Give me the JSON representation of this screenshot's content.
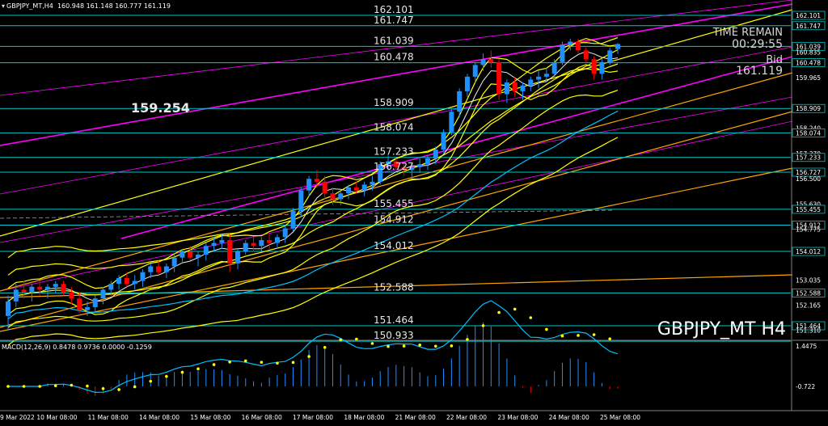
{
  "header": {
    "symbol_tf": "GBPJPY_MT,H4",
    "ohlc": "160.948 161.148 160.777 161.119"
  },
  "watermark": "GBPJPY_MT H4",
  "timer": {
    "label": "TIME REMAIN",
    "value": "00:29:55",
    "bid_label": "Bid",
    "bid_value": "161.119"
  },
  "big_level_label": "159.254",
  "levels": [
    {
      "value": 162.101,
      "label": "162.101"
    },
    {
      "value": 161.747,
      "label": "161.747"
    },
    {
      "value": 161.039,
      "label": "161.039"
    },
    {
      "value": 160.478,
      "label": "160.478"
    },
    {
      "value": 158.909,
      "label": "158.909"
    },
    {
      "value": 158.074,
      "label": "158.074"
    },
    {
      "value": 157.233,
      "label": "157.233"
    },
    {
      "value": 156.727,
      "label": "156.727"
    },
    {
      "value": 155.455,
      "label": "155.455"
    },
    {
      "value": 154.912,
      "label": "154.912"
    },
    {
      "value": 154.012,
      "label": "154.012"
    },
    {
      "value": 152.588,
      "label": "152.588"
    },
    {
      "value": 151.464,
      "label": "151.464"
    },
    {
      "value": 150.933,
      "label": "150.933"
    }
  ],
  "price_axis_ticks": [
    {
      "value": 162.101,
      "label": "162.101",
      "boxed": true
    },
    {
      "value": 161.747,
      "label": "161.747",
      "boxed": true
    },
    {
      "value": 161.039,
      "label": "161.039",
      "boxed": true
    },
    {
      "value": 160.835,
      "label": "160.835",
      "boxed": false
    },
    {
      "value": 160.478,
      "label": "160.478",
      "boxed": true
    },
    {
      "value": 159.965,
      "label": "159.965",
      "boxed": false
    },
    {
      "value": 158.909,
      "label": "158.909",
      "boxed": true
    },
    {
      "value": 158.24,
      "label": "158.240",
      "boxed": false
    },
    {
      "value": 158.074,
      "label": "158.074",
      "boxed": true
    },
    {
      "value": 157.37,
      "label": "157.370",
      "boxed": false
    },
    {
      "value": 157.233,
      "label": "157.233",
      "boxed": true
    },
    {
      "value": 156.727,
      "label": "156.727",
      "boxed": true
    },
    {
      "value": 156.5,
      "label": "156.500",
      "boxed": false
    },
    {
      "value": 155.63,
      "label": "155.630",
      "boxed": false
    },
    {
      "value": 155.455,
      "label": "155.455",
      "boxed": true
    },
    {
      "value": 154.912,
      "label": "154.912",
      "boxed": true
    },
    {
      "value": 154.775,
      "label": "154.775",
      "boxed": false
    },
    {
      "value": 154.012,
      "label": "154.012",
      "boxed": true
    },
    {
      "value": 153.035,
      "label": "153.035",
      "boxed": false
    },
    {
      "value": 152.588,
      "label": "152.588",
      "boxed": true
    },
    {
      "value": 152.165,
      "label": "152.165",
      "boxed": false
    },
    {
      "value": 151.464,
      "label": "151.464",
      "boxed": true
    },
    {
      "value": 151.31,
      "label": "151.310",
      "boxed": false
    }
  ],
  "macd": {
    "label": "MACD(12,26,9) 0.8478 0.9736 0.0000 -0.1259",
    "axis_ticks": [
      {
        "value": 1.4475,
        "label": "1.4475"
      },
      {
        "value": -0.722,
        "label": "-0.722"
      }
    ]
  },
  "time_axis": [
    "9 Mar 2022",
    "10 Mar 08:00",
    "11 Mar 08:00",
    "14 Mar 08:00",
    "15 Mar 08:00",
    "16 Mar 08:00",
    "17 Mar 08:00",
    "18 Mar 08:00",
    "21 Mar 08:00",
    "22 Mar 08:00",
    "23 Mar 08:00",
    "24 Mar 08:00",
    "25 Mar 08:00"
  ],
  "colors": {
    "background": "#000000",
    "bull": "#1e90ff",
    "bear": "#ff0000",
    "level_line": "#00c8c8",
    "magenta_line": "#ff00ff",
    "yellow_line": "#ffff00",
    "orange_line": "#ffa500",
    "macd_line": "#00bfff",
    "macd_signal": "#ffff00",
    "histogram_pos": "#1e90ff",
    "histogram_neg": "#ff0000"
  },
  "chart_data": {
    "type": "candlestick",
    "candles": [
      [
        151.8,
        152.5,
        151.3,
        152.3
      ],
      [
        152.3,
        152.9,
        152.1,
        152.7
      ],
      [
        152.7,
        153.0,
        152.4,
        152.6
      ],
      [
        152.6,
        152.9,
        152.3,
        152.8
      ],
      [
        152.8,
        153.0,
        152.5,
        152.7
      ],
      [
        152.7,
        152.9,
        152.4,
        152.8
      ],
      [
        152.8,
        153.0,
        152.6,
        152.9
      ],
      [
        152.9,
        153.0,
        152.5,
        152.6
      ],
      [
        152.6,
        152.8,
        152.2,
        152.4
      ],
      [
        152.4,
        152.6,
        151.9,
        152.0
      ],
      [
        152.0,
        152.3,
        151.8,
        152.1
      ],
      [
        152.1,
        152.5,
        151.9,
        152.4
      ],
      [
        152.4,
        152.8,
        152.2,
        152.7
      ],
      [
        152.7,
        153.0,
        152.5,
        152.9
      ],
      [
        152.9,
        153.2,
        152.7,
        153.1
      ],
      [
        153.1,
        153.3,
        152.8,
        152.9
      ],
      [
        152.9,
        153.2,
        152.7,
        153.0
      ],
      [
        153.0,
        153.4,
        152.8,
        153.3
      ],
      [
        153.3,
        153.6,
        153.1,
        153.5
      ],
      [
        153.5,
        153.7,
        153.2,
        153.3
      ],
      [
        153.3,
        153.6,
        153.1,
        153.5
      ],
      [
        153.5,
        153.9,
        153.3,
        153.8
      ],
      [
        153.8,
        154.1,
        153.6,
        154.0
      ],
      [
        154.0,
        154.2,
        153.7,
        153.8
      ],
      [
        153.8,
        154.0,
        153.5,
        153.9
      ],
      [
        153.9,
        154.3,
        153.7,
        154.2
      ],
      [
        154.2,
        154.5,
        154.0,
        154.3
      ],
      [
        154.3,
        154.6,
        154.1,
        154.4
      ],
      [
        154.4,
        154.6,
        153.3,
        153.6
      ],
      [
        153.6,
        154.1,
        153.4,
        154.0
      ],
      [
        154.0,
        154.4,
        153.9,
        154.3
      ],
      [
        154.3,
        154.5,
        154.0,
        154.2
      ],
      [
        154.2,
        154.5,
        154.0,
        154.4
      ],
      [
        154.4,
        154.6,
        154.1,
        154.3
      ],
      [
        154.3,
        154.6,
        154.1,
        154.5
      ],
      [
        154.5,
        154.9,
        154.3,
        154.8
      ],
      [
        154.8,
        155.5,
        154.7,
        155.4
      ],
      [
        155.4,
        156.2,
        155.2,
        156.1
      ],
      [
        156.1,
        156.6,
        155.9,
        156.5
      ],
      [
        156.5,
        156.8,
        156.2,
        156.4
      ],
      [
        156.4,
        156.6,
        155.8,
        156.0
      ],
      [
        156.0,
        156.2,
        155.6,
        155.8
      ],
      [
        155.8,
        156.1,
        155.6,
        156.0
      ],
      [
        156.0,
        156.3,
        155.8,
        156.2
      ],
      [
        156.2,
        156.4,
        156.0,
        156.1
      ],
      [
        156.1,
        156.4,
        155.9,
        156.3
      ],
      [
        156.3,
        156.6,
        156.1,
        156.4
      ],
      [
        156.4,
        157.1,
        156.3,
        157.0
      ],
      [
        157.0,
        157.3,
        156.8,
        157.1
      ],
      [
        157.1,
        157.2,
        156.8,
        156.9
      ],
      [
        156.9,
        157.1,
        156.6,
        156.8
      ],
      [
        156.8,
        157.0,
        156.5,
        156.9
      ],
      [
        156.9,
        157.2,
        156.7,
        157.0
      ],
      [
        157.0,
        157.3,
        156.8,
        157.2
      ],
      [
        157.2,
        157.6,
        157.0,
        157.5
      ],
      [
        157.5,
        158.2,
        157.4,
        158.1
      ],
      [
        158.1,
        158.9,
        158.0,
        158.8
      ],
      [
        158.8,
        159.6,
        158.6,
        159.5
      ],
      [
        159.5,
        160.1,
        159.3,
        160.0
      ],
      [
        160.0,
        160.5,
        159.8,
        160.4
      ],
      [
        160.4,
        160.8,
        160.2,
        160.6
      ],
      [
        160.6,
        160.9,
        160.3,
        160.5
      ],
      [
        160.5,
        160.6,
        159.2,
        159.4
      ],
      [
        159.4,
        159.9,
        159.1,
        159.8
      ],
      [
        159.8,
        160.0,
        159.3,
        159.5
      ],
      [
        159.5,
        159.8,
        159.2,
        159.7
      ],
      [
        159.7,
        160.0,
        159.5,
        159.9
      ],
      [
        159.9,
        160.2,
        159.6,
        160.0
      ],
      [
        160.0,
        160.3,
        159.8,
        160.1
      ],
      [
        160.1,
        160.6,
        159.9,
        160.5
      ],
      [
        160.5,
        161.2,
        160.4,
        161.1
      ],
      [
        161.1,
        161.3,
        160.9,
        161.2
      ],
      [
        161.2,
        161.3,
        160.8,
        160.9
      ],
      [
        160.9,
        161.0,
        160.5,
        160.6
      ],
      [
        160.6,
        160.7,
        159.9,
        160.1
      ],
      [
        160.1,
        160.6,
        159.9,
        160.5
      ],
      [
        160.5,
        161.0,
        160.4,
        160.9
      ],
      [
        160.948,
        161.148,
        160.777,
        161.119
      ]
    ]
  }
}
